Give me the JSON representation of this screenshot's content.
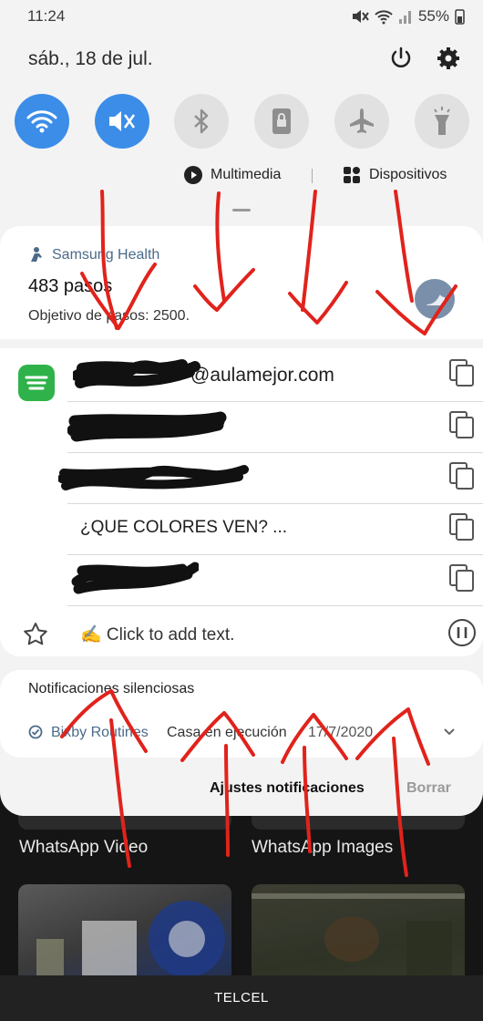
{
  "status_bar": {
    "time": "11:24",
    "battery": "55%"
  },
  "header": {
    "date": "sáb., 18 de jul."
  },
  "quick_settings": [
    {
      "name": "wifi",
      "active": true
    },
    {
      "name": "sound-mute",
      "active": true
    },
    {
      "name": "bluetooth",
      "active": false
    },
    {
      "name": "lock-rotation",
      "active": false
    },
    {
      "name": "airplane",
      "active": false
    },
    {
      "name": "flashlight",
      "active": false
    }
  ],
  "media_bar": {
    "multimedia": "Multimedia",
    "devices": "Dispositivos"
  },
  "samsung_health": {
    "app": "Samsung Health",
    "steps": "483 pasos",
    "goal": "Objetivo de pasos: 2500."
  },
  "clipboard": {
    "rows": [
      {
        "text": "@aulamejor.com"
      },
      {
        "text": ""
      },
      {
        "text": ""
      },
      {
        "text": "¿QUE COLORES VEN? ..."
      },
      {
        "text": ""
      }
    ],
    "add_text": "✍ Click to add text."
  },
  "silent": {
    "title": "Notificaciones silenciosas",
    "app": "Bixby Routines",
    "message": "Casa en ejecución",
    "date": "17/7/2020"
  },
  "footer": {
    "settings": "Ajustes notificaciones",
    "clear": "Borrar"
  },
  "background": {
    "label_left": "WhatsApp Video",
    "label_right": "WhatsApp Images",
    "carrier": "TELCEL"
  },
  "colors": {
    "accent": "#3b8de8",
    "scribble": "#e0231c",
    "redaction": "#111111"
  }
}
